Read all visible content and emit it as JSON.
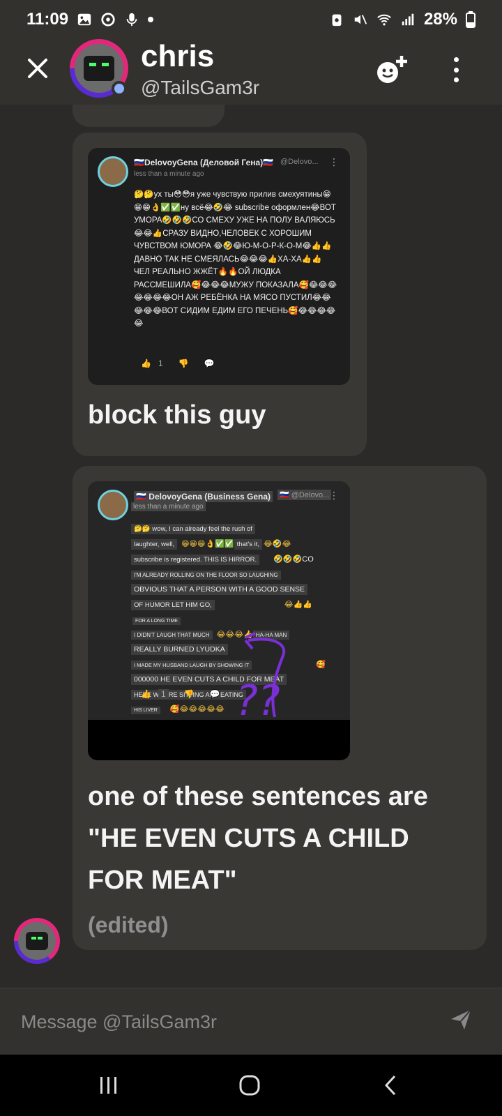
{
  "status_bar": {
    "time": "11:09",
    "battery": "28%"
  },
  "header": {
    "name": "chris",
    "handle": "@TailsGam3r",
    "close_icon": "close-icon",
    "add_friend_icon": "add-friend-icon",
    "more_icon": "more-vertical-icon"
  },
  "messages": [
    {
      "screenshot": {
        "author": "DelovoyGena (Деловой Гена)",
        "handle": "@Delovo...",
        "time": "less than a minute ago",
        "text": "🤔🤔ух ты😳😳я уже чувствую прилив смехуятины😁😁😁👌✅✅ну всё😂🤣😂 subscribe оформлен😂ВОТ УМОРА🤣🤣🤣СО СМЕХУ УЖЕ НА ПОЛУ ВАЛЯЮСЬ😂😂👍СРАЗУ ВИДНО,ЧЕЛОВЕК С ХОРОШИМ ЧУВСТВОМ ЮМОРА 😂🤣😂Ю-М-О-Р-К-О-М😂👍👍ДАВНО ТАК НЕ СМЕЯЛАСЬ😂😂😂👍ХА-ХА👍👍ЧЕЛ РЕАЛЬНО ЖЖЁТ🔥🔥ОЙ ЛЮДКА РАССМЕШИЛА🥰😂😂😂МУЖУ ПОКАЗАЛА🥰😂😂😂😂😂😂😂ОН АЖ РЕБЁНКА НА МЯСО ПУСТИЛ😂😂😂😂😂ВОТ СИДИМ ЕДИМ ЕГО ПЕЧЕНЬ🥰😂😂😂😂😂",
        "likes": "1"
      },
      "caption": "block this guy"
    },
    {
      "screenshot": {
        "author": "DelovoyGena (Business Gena)",
        "handle": "@Delovo...",
        "time": "less than a minute ago",
        "lines": [
          "wow, I can already feel the rush of",
          "laughter, well,",
          "that's it,",
          "subscribe is registered. THIS IS HIRROR.",
          "I'M ALREADY ROLLING ON THE FLOOR SO LAUGHING",
          "OBVIOUS THAT A PERSON WITH A GOOD SENSE",
          "OF HUMOR LET HIM GO,",
          "FOR A LONG TIME",
          "I DIDN'T LAUGH THAT MUCH",
          "HA-HA MAN",
          "REALLY BURNED LYUDKA",
          "I MADE MY HUSBAND LAUGH BY SHOWING IT",
          "000000 HE EVEN CUTS A CHILD FOR MEAT",
          "HERE WE ARE SITTING AND EATING",
          "HIS LIVER"
        ],
        "emoji_co": "🤣🤣🤣CO",
        "likes": "1",
        "annotation": "??"
      },
      "caption": "one of these sentences are \"HE EVEN CUTS A CHILD FOR MEAT\"",
      "edited": "(edited)"
    }
  ],
  "composer": {
    "placeholder": "Message @TailsGam3r",
    "send_icon": "send-icon"
  },
  "nav": {
    "recents_icon": "recent-apps-icon",
    "home_icon": "home-icon",
    "back_icon": "back-icon"
  }
}
